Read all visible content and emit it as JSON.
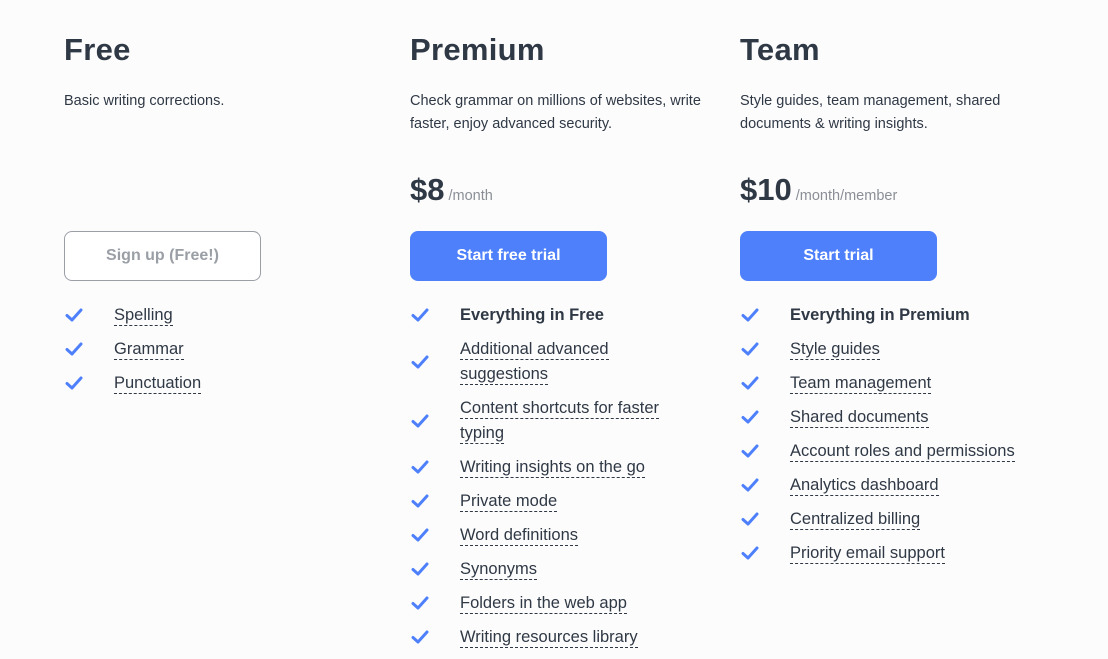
{
  "colors": {
    "accent": "#4e80fb",
    "text": "#2f3845",
    "muted": "#8a8f96",
    "background": "#fcfcfc"
  },
  "plans": [
    {
      "id": "free",
      "title": "Free",
      "description": "Basic writing corrections.",
      "price": null,
      "cta": {
        "label": "Sign up (Free!)",
        "style": "outline"
      },
      "features": [
        {
          "text": "Spelling",
          "icon": "checkmark-icon"
        },
        {
          "text": "Grammar",
          "icon": "checkmark-icon"
        },
        {
          "text": "Punctuation",
          "icon": "checkmark-icon"
        }
      ]
    },
    {
      "id": "premium",
      "title": "Premium",
      "description": "Check grammar on millions of websites, write faster, enjoy advanced security.",
      "price": {
        "amount": "$8",
        "period": "/month"
      },
      "cta": {
        "label": "Start free trial",
        "style": "primary"
      },
      "features": [
        {
          "text": "Everything in Free",
          "icon": "checkmark-icon",
          "bold": true
        },
        {
          "text": "Additional advanced suggestions",
          "icon": "checkmark-icon"
        },
        {
          "text": "Content shortcuts for faster typing",
          "icon": "checkmark-icon"
        },
        {
          "text": "Writing insights on the go",
          "icon": "checkmark-icon"
        },
        {
          "text": "Private mode",
          "icon": "checkmark-icon"
        },
        {
          "text": "Word definitions",
          "icon": "checkmark-icon"
        },
        {
          "text": "Synonyms",
          "icon": "checkmark-icon"
        },
        {
          "text": "Folders in the web app",
          "icon": "checkmark-icon"
        },
        {
          "text": "Writing resources library",
          "icon": "checkmark-icon"
        }
      ]
    },
    {
      "id": "team",
      "title": "Team",
      "description": "Style guides, team management, shared documents & writing insights.",
      "price": {
        "amount": "$10",
        "period": "/month/member"
      },
      "cta": {
        "label": "Start trial",
        "style": "primary"
      },
      "features": [
        {
          "text": "Everything in Premium",
          "icon": "checkmark-icon",
          "bold": true
        },
        {
          "text": "Style guides",
          "icon": "checkmark-icon"
        },
        {
          "text": "Team management",
          "icon": "checkmark-icon"
        },
        {
          "text": "Shared documents",
          "icon": "checkmark-icon"
        },
        {
          "text": "Account roles and permissions",
          "icon": "checkmark-icon"
        },
        {
          "text": "Analytics dashboard",
          "icon": "checkmark-icon"
        },
        {
          "text": "Centralized billing",
          "icon": "checkmark-icon"
        },
        {
          "text": "Priority email support",
          "icon": "checkmark-icon"
        }
      ]
    }
  ]
}
